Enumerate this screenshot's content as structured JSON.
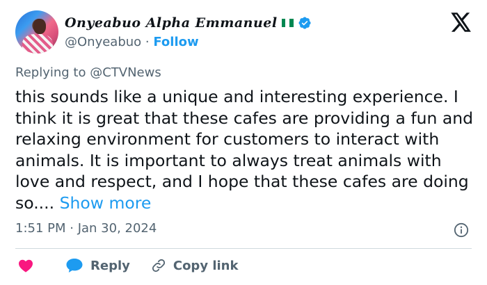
{
  "user": {
    "display_name": "𝑶𝒏𝒚𝒆𝒂𝒃𝒖𝒐 𝑨𝒍𝒑𝒉𝒂 𝑬𝒎𝒎𝒂𝒏𝒖𝒆𝒍",
    "handle": "@Onyeabuo",
    "separator": " · ",
    "follow_label": "Follow",
    "flag": "nigeria-flag",
    "verified_badge": "verified-badge-icon"
  },
  "brand_icon": "x-logo-icon",
  "tweet": {
    "replying_to": "Replying to @CTVNews",
    "text": "this sounds like a unique and interesting experience. I think it is great that these cafes are providing a fun and relaxing environment for customers to interact with animals. It is important to always treat animals with love and respect, and I hope that these cafes are doing so.... ",
    "show_more_label": "Show more",
    "timestamp": "1:51 PM · Jan 30, 2024"
  },
  "actions": {
    "like_icon": "heart-icon",
    "reply_label": "Reply",
    "copy_link_label": "Copy link"
  },
  "colors": {
    "accent": "#1d9bf0",
    "like": "#f91880",
    "secondary_text": "#536471",
    "divider": "#cfd9de"
  }
}
